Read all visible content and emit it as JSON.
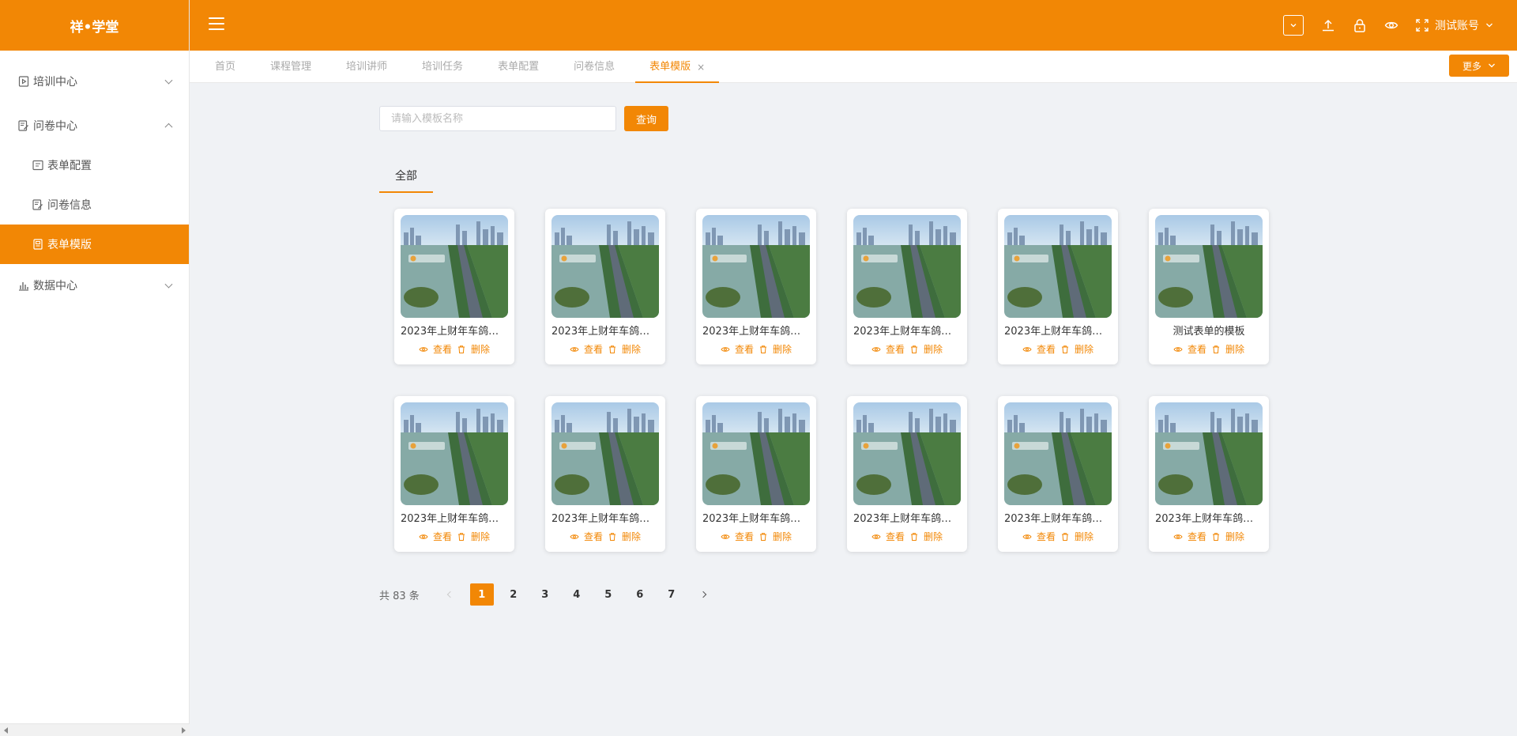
{
  "app": {
    "title": "祥•学堂"
  },
  "sidebar": {
    "items": [
      {
        "label": "培训中心",
        "icon": "video-doc-icon"
      },
      {
        "label": "问卷中心",
        "icon": "edit-doc-icon"
      },
      {
        "label": "数据中心",
        "icon": "bar-chart-icon"
      }
    ],
    "submenu": [
      {
        "label": "表单配置",
        "icon": "form-config-icon"
      },
      {
        "label": "问卷信息",
        "icon": "survey-info-icon"
      },
      {
        "label": "表单模版",
        "icon": "template-icon"
      }
    ]
  },
  "header": {
    "account": "测试账号"
  },
  "tabs": [
    {
      "label": "首页"
    },
    {
      "label": "课程管理"
    },
    {
      "label": "培训讲师"
    },
    {
      "label": "培训任务"
    },
    {
      "label": "表单配置"
    },
    {
      "label": "问卷信息"
    },
    {
      "label": "表单模版",
      "active": true,
      "close": "×"
    }
  ],
  "more_label": "更多",
  "search": {
    "placeholder": "请输入模板名称",
    "button": "查询"
  },
  "category_tab": "全部",
  "cards": [
    {
      "title": "2023年上财年车鸽平..."
    },
    {
      "title": "2023年上财年车鸽平..."
    },
    {
      "title": "2023年上财年车鸽平..."
    },
    {
      "title": "2023年上财年车鸽平..."
    },
    {
      "title": "2023年上财年车鸽平..."
    },
    {
      "title": "测试表单的模板"
    },
    {
      "title": "2023年上财年车鸽平..."
    },
    {
      "title": "2023年上财年车鸽平..."
    },
    {
      "title": "2023年上财年车鸽平..."
    },
    {
      "title": "2023年上财年车鸽平..."
    },
    {
      "title": "2023年上财年车鸽平..."
    },
    {
      "title": "2023年上财年车鸽平..."
    }
  ],
  "card_actions": {
    "view": "查看",
    "delete": "删除"
  },
  "pagination": {
    "total": "共 83 条",
    "pages": [
      "1",
      "2",
      "3",
      "4",
      "5",
      "6",
      "7"
    ],
    "current": "1"
  },
  "colors": {
    "accent": "#f28705",
    "background": "#f0f2f5"
  }
}
